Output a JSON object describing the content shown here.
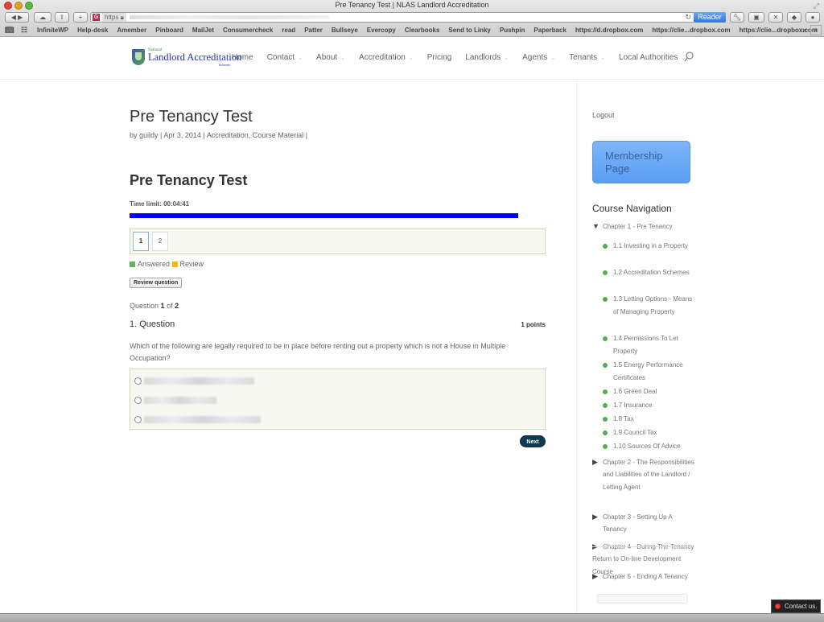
{
  "browser": {
    "window_title": "Pre Tenancy Test | NLAS Landlord Accreditation",
    "url_scheme": "https",
    "reader_label": "Reader",
    "bookmarks": [
      "InfiniteWP",
      "Help-desk",
      "Amember",
      "Pinboard",
      "MailJet",
      "Consumercheck",
      "read",
      "Patter",
      "Bullseye",
      "Evercopy",
      "Clearbooks",
      "Send to Linky",
      "Pushpin",
      "Paperback",
      "https://d.dropbox.com",
      "https://clie...dropbox.com",
      "https://clie...dropbox.com"
    ],
    "bookmarks_more": "»",
    "add_tab": "+"
  },
  "site": {
    "logo": {
      "small_top": "National",
      "main": "Landlord Accreditation",
      "small_bottom": "Scheme"
    },
    "nav": [
      {
        "label": "Home",
        "dropdown": false
      },
      {
        "label": "Contact",
        "dropdown": true
      },
      {
        "label": "About",
        "dropdown": true
      },
      {
        "label": "Accreditation",
        "dropdown": true
      },
      {
        "label": "Pricing",
        "dropdown": false
      },
      {
        "label": "Landlords",
        "dropdown": true
      },
      {
        "label": "Agents",
        "dropdown": true
      },
      {
        "label": "Tenants",
        "dropdown": true
      },
      {
        "label": "Local Authorities",
        "dropdown": true
      }
    ]
  },
  "post": {
    "title": "Pre Tenancy Test",
    "meta": "by guildy | Apr 3, 2014 | Accreditation, Course Material |"
  },
  "quiz": {
    "title": "Pre Tenancy Test",
    "time_limit": "Time limit: 00:04:41",
    "time_remaining_fraction": 0.934,
    "timer_color": "#0000ff",
    "question_numbers": [
      "1",
      "2"
    ],
    "active_question": "1",
    "legend": {
      "answered": "Answered",
      "answered_color": "#5cb85c",
      "review": "Review",
      "review_color": "#ffb800"
    },
    "review_button": "Review question",
    "question_count_prefix": "Question",
    "current": "1",
    "of": "of",
    "total": "2",
    "question_heading": "1. Question",
    "points": "1 points",
    "question_text": "Which of the following are legally required to be in place before renting out a property which is not a House in Multiple Occupation?",
    "answers_count_visible": 3,
    "next_button": "Next"
  },
  "sidebar": {
    "logout": "Logout",
    "membership_button": "Membership Page",
    "course_nav_title": "Course Navigation",
    "chapters": [
      {
        "label": "Chapter 1 - Pre Tenancy",
        "expanded": true,
        "lessons": [
          {
            "label": "1.1 Investing in a Property",
            "status": "complete"
          },
          {
            "label": "1.2 Accreditation Schemes",
            "status": "complete"
          },
          {
            "label": "1.3 Letting Options - Means of Managing Property",
            "status": "complete"
          },
          {
            "label": "1.4 Permissions To Let Property",
            "status": "complete"
          },
          {
            "label": "1.5 Energy Performance Certificates",
            "status": "complete"
          },
          {
            "label": "1.6 Green Deal",
            "status": "complete"
          },
          {
            "label": "1.7 Insurance",
            "status": "complete"
          },
          {
            "label": "1.8 Tax",
            "status": "complete"
          },
          {
            "label": "1.9 Council Tax",
            "status": "complete"
          },
          {
            "label": "1.10 Sources Of Advice",
            "status": "complete"
          }
        ]
      },
      {
        "label": "Chapter 2 - The Responsibilities and Liabilities of the Landlord / Letting Agent",
        "expanded": false
      },
      {
        "label": "Chapter 3 - Setting Up A Tenancy",
        "expanded": false
      },
      {
        "label": "Chapter 4 - During The Tenancy",
        "expanded": false
      },
      {
        "label": "Chapter 5 - Ending A Tenancy",
        "expanded": false
      }
    ],
    "return_link": "Return to On-line Development Course"
  },
  "contact_widget": "Contact us."
}
